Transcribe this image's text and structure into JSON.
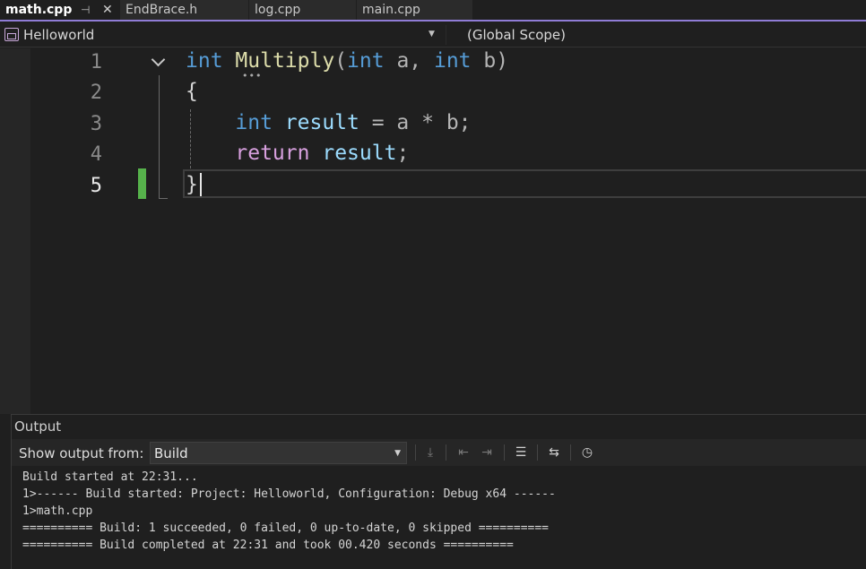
{
  "tabs": [
    {
      "label": "math.cpp",
      "active": true
    },
    {
      "label": "EndBrace.h",
      "active": false
    },
    {
      "label": "log.cpp",
      "active": false
    },
    {
      "label": "main.cpp",
      "active": false
    }
  ],
  "nav": {
    "project": "Helloworld",
    "scope": "(Global Scope)"
  },
  "editor": {
    "line_numbers": [
      "1",
      "2",
      "3",
      "4",
      "5"
    ],
    "current_line": "5",
    "lines": [
      {
        "kw_int": "int",
        "fn_name": "Multiply",
        "open": "(",
        "kw_int2": "int",
        "param_a": " a, ",
        "kw_int3": "int",
        "param_b": " b)"
      },
      {
        "text": "{"
      },
      {
        "indent": "    ",
        "type": "int",
        "var": "result",
        "rest": " = a * b;"
      },
      {
        "indent": "    ",
        "kw": "return",
        "var": "result",
        "rest": ";"
      },
      {
        "text": "}"
      }
    ]
  },
  "output": {
    "title": "Output",
    "show_label": "Show output from:",
    "source": "Build",
    "log": [
      "Build started at 22:31...",
      "1>------ Build started: Project: Helloworld, Configuration: Debug x64 ------",
      "1>math.cpp",
      "========== Build: 1 succeeded, 0 failed, 0 up-to-date, 0 skipped ==========",
      "========== Build completed at 22:31 and took 00.420 seconds =========="
    ]
  },
  "colors": {
    "accent": "#8f7cd6",
    "keyword": "#569cd6",
    "control_keyword": "#d8a0df",
    "function": "#dcdcaa",
    "variable": "#9cdcfe",
    "change_marker": "#56b24b"
  }
}
